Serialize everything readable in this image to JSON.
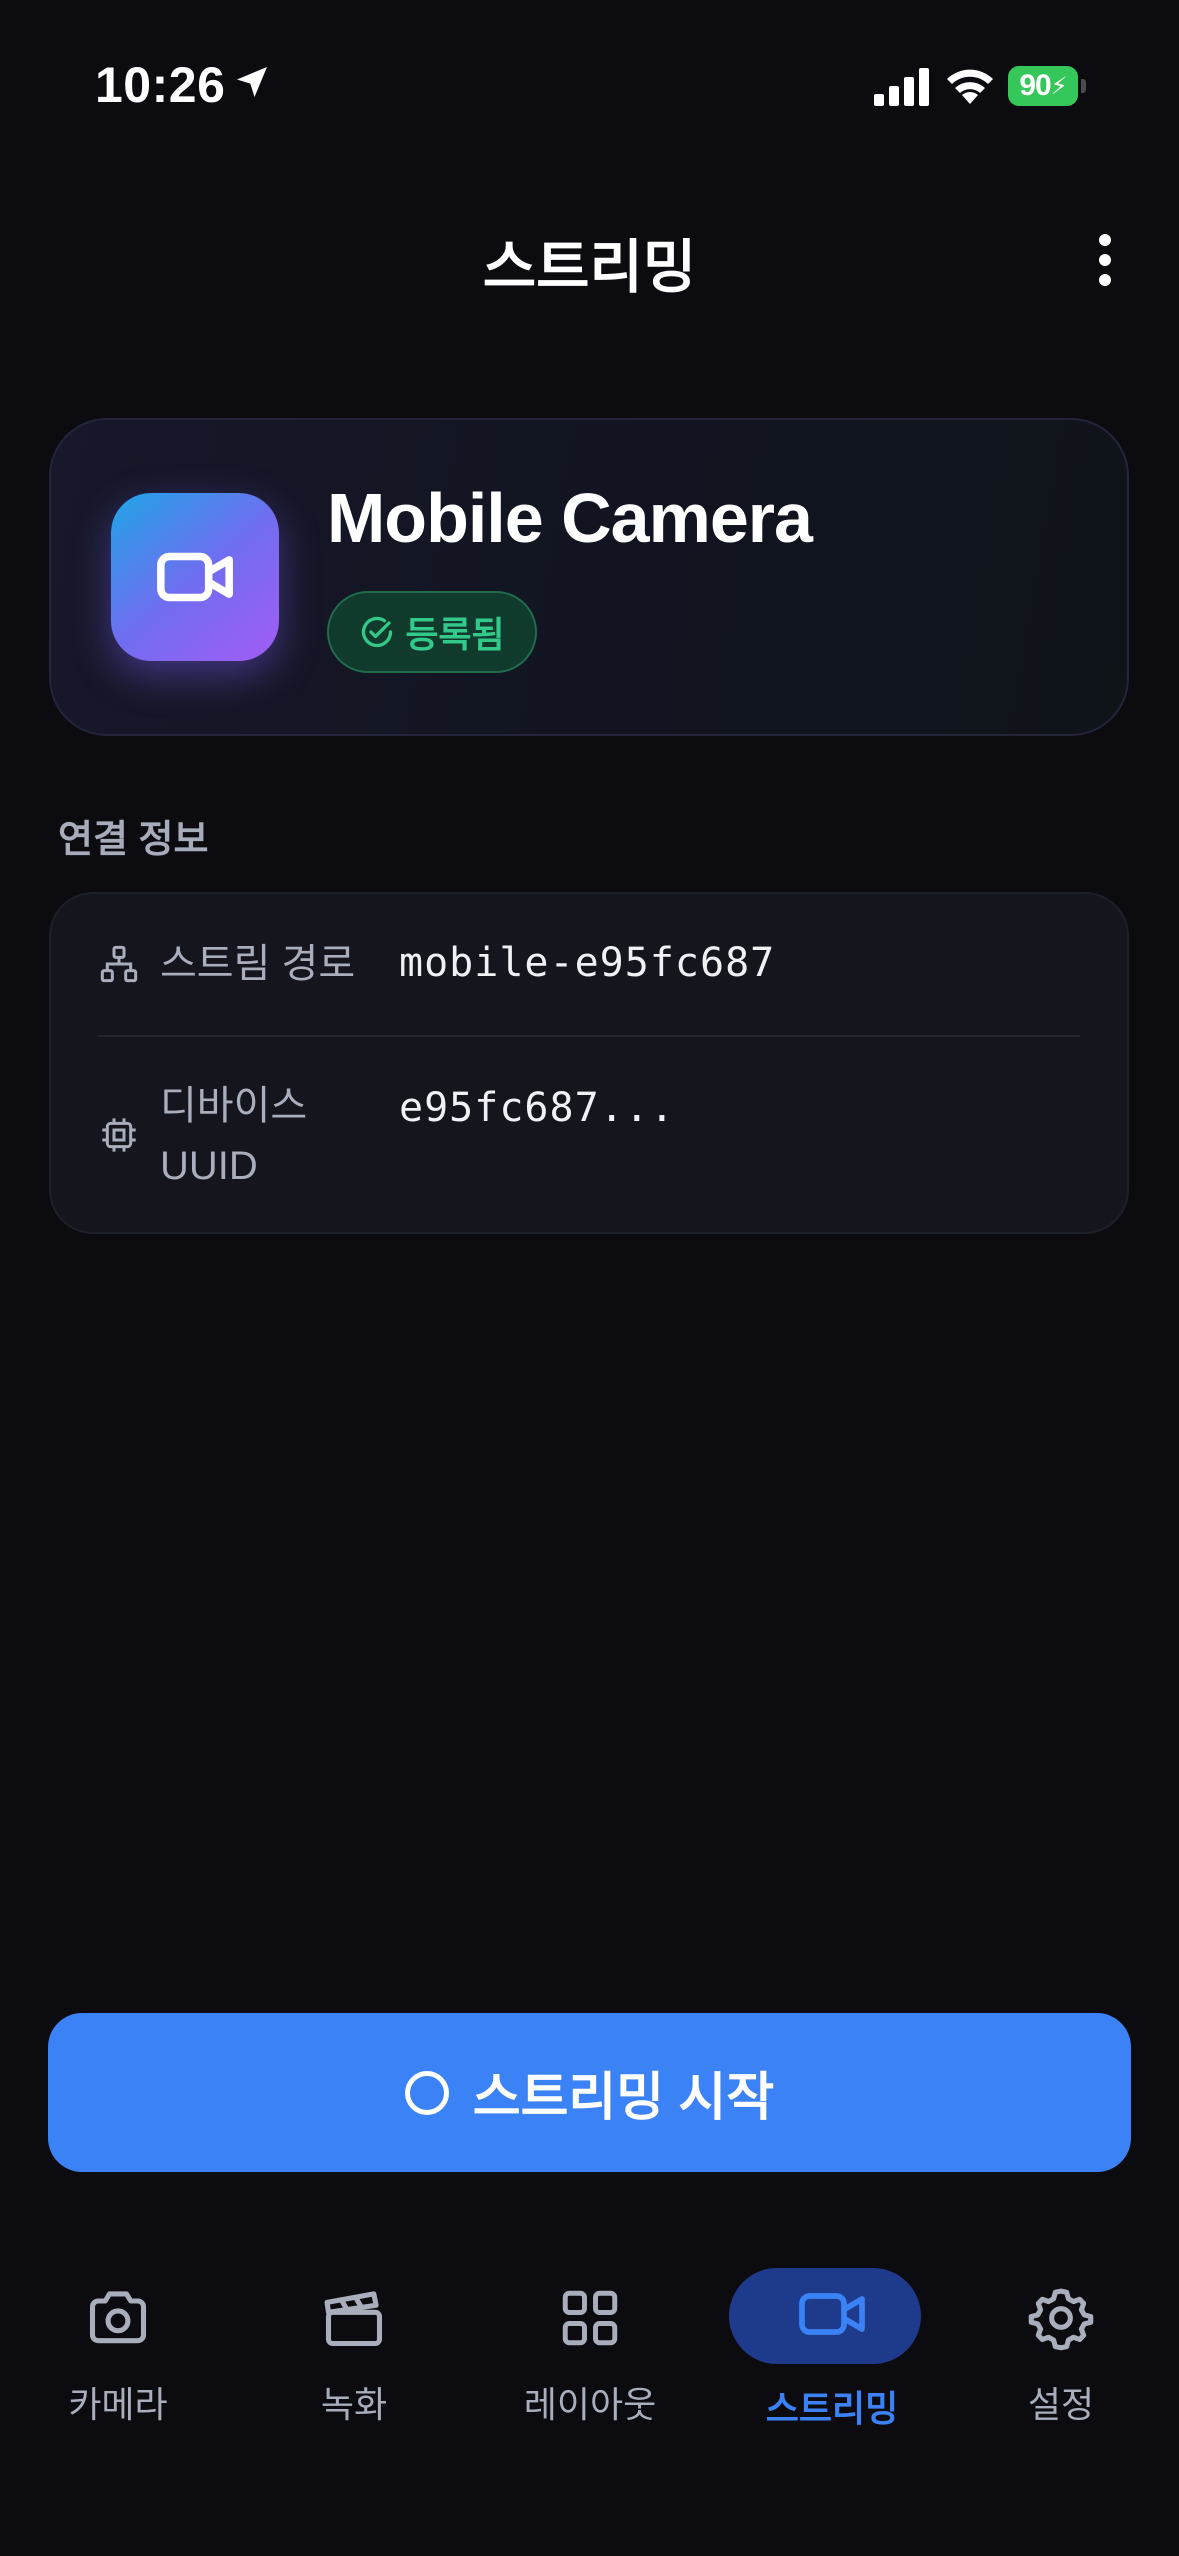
{
  "status_bar": {
    "time": "10:26",
    "battery": "90"
  },
  "header": {
    "title": "스트리밍"
  },
  "device": {
    "name": "Mobile Camera",
    "status": "등록됨"
  },
  "connection": {
    "section_label": "연결 정보",
    "rows": [
      {
        "label": "스트림 경로",
        "value": "mobile-e95fc687"
      },
      {
        "label_line1": "디바이스",
        "label_line2": "UUID",
        "value": "e95fc687..."
      }
    ]
  },
  "start_button": {
    "label": "스트리밍 시작"
  },
  "tabs": [
    {
      "label": "카메라",
      "icon": "camera-icon"
    },
    {
      "label": "녹화",
      "icon": "clapperboard-icon"
    },
    {
      "label": "레이아웃",
      "icon": "grid-icon"
    },
    {
      "label": "스트리밍",
      "icon": "video-icon",
      "active": true
    },
    {
      "label": "설정",
      "icon": "gear-icon"
    }
  ],
  "colors": {
    "accent": "#3b82f6",
    "success": "#33c98a",
    "background": "#0b0b10"
  }
}
